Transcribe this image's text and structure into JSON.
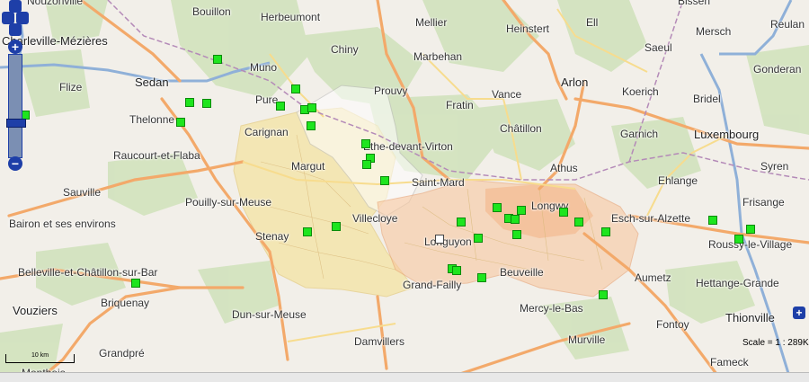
{
  "map": {
    "places": [
      {
        "name": "Nouzonville"
      },
      {
        "name": "Bouillon"
      },
      {
        "name": "Herbeumont"
      },
      {
        "name": "Bissen"
      },
      {
        "name": "Charleville-Mézières"
      },
      {
        "name": "Mellier"
      },
      {
        "name": "Heinstert"
      },
      {
        "name": "Ell"
      },
      {
        "name": "Mersch"
      },
      {
        "name": "Reulan"
      },
      {
        "name": "Chiny"
      },
      {
        "name": "Saeul"
      },
      {
        "name": "Gonderan"
      },
      {
        "name": "Muno"
      },
      {
        "name": "Marbehan"
      },
      {
        "name": "Sedan"
      },
      {
        "name": "Arlon"
      },
      {
        "name": "Flize"
      },
      {
        "name": "Prouvy"
      },
      {
        "name": "Vance"
      },
      {
        "name": "Koerich"
      },
      {
        "name": "Bridel"
      },
      {
        "name": "Pure"
      },
      {
        "name": "Fratin"
      },
      {
        "name": "Thelonne"
      },
      {
        "name": "Châtillon"
      },
      {
        "name": "Carignan"
      },
      {
        "name": "Garnich"
      },
      {
        "name": "Luxembourg"
      },
      {
        "name": "Ethe-devant-Virton"
      },
      {
        "name": "Raucourt-et-Flaba"
      },
      {
        "name": "Margut"
      },
      {
        "name": "Athus"
      },
      {
        "name": "Syren"
      },
      {
        "name": "Saint-Mard"
      },
      {
        "name": "Ehlange"
      },
      {
        "name": "Sauville"
      },
      {
        "name": "Pouilly-sur-Meuse"
      },
      {
        "name": "Frisange"
      },
      {
        "name": "Longwy"
      },
      {
        "name": "Esch-sur-Alzette"
      },
      {
        "name": "Villecloye"
      },
      {
        "name": "Bairon et ses environs"
      },
      {
        "name": "Stenay"
      },
      {
        "name": "Longuyon"
      },
      {
        "name": "Roussy-le-Village"
      },
      {
        "name": "Belleville-et-Châtillon-sur-Bar"
      },
      {
        "name": "Beuveille"
      },
      {
        "name": "Grand-Failly"
      },
      {
        "name": "Hettange-Grande"
      },
      {
        "name": "Aumetz"
      },
      {
        "name": "Briquenay"
      },
      {
        "name": "Vouziers"
      },
      {
        "name": "Dun-sur-Meuse"
      },
      {
        "name": "Mercy-le-Bas"
      },
      {
        "name": "Thionville"
      },
      {
        "name": "Fontoy"
      },
      {
        "name": "Damvillers"
      },
      {
        "name": "Murville"
      },
      {
        "name": "Grandpré"
      },
      {
        "name": "Fameck"
      },
      {
        "name": "Monthois"
      }
    ],
    "markers_count": 34
  },
  "controls": {
    "zoom_in": "+",
    "zoom_out": "−",
    "layer_switcher": "+"
  },
  "scale_bar_label": "10 km",
  "scale_text": "Scale = 1 : 289K"
}
